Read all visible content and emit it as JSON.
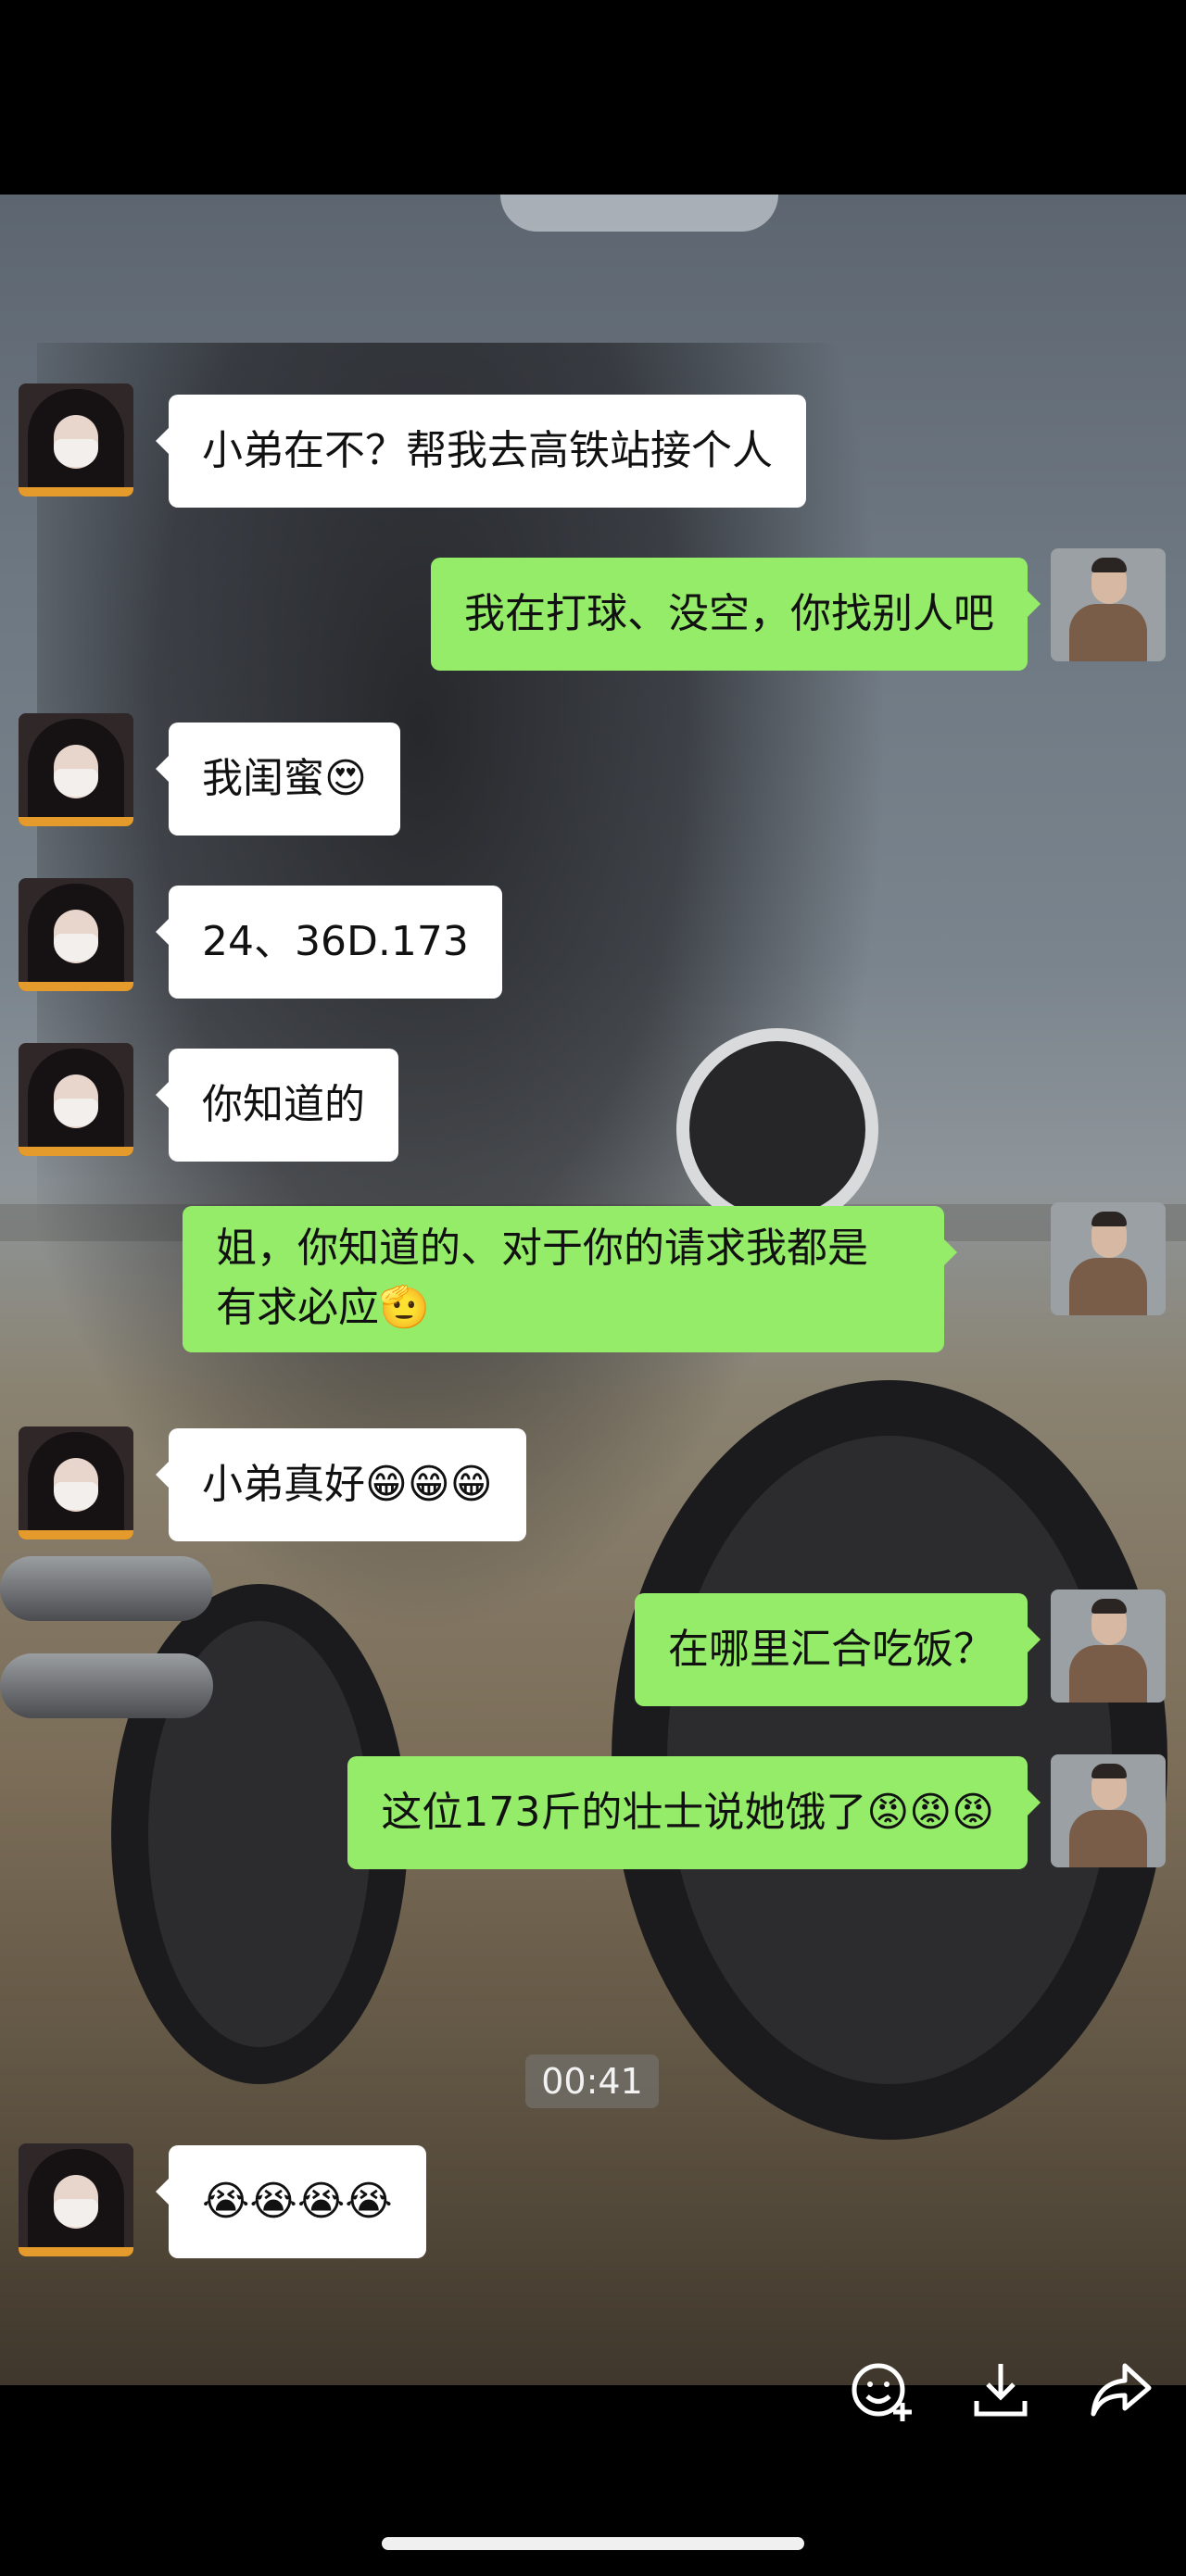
{
  "messages": [
    {
      "side": "left",
      "text": "小弟在不？帮我去高铁站接个人"
    },
    {
      "side": "right",
      "text": "我在打球、没空，你找别人吧"
    },
    {
      "side": "left",
      "text": "我闺蜜😍"
    },
    {
      "side": "left",
      "text": "24、36D.173"
    },
    {
      "side": "left",
      "text": "你知道的"
    },
    {
      "side": "right",
      "line1": "姐，你知道的、对于你的请求我都是",
      "line2": "有求必应🫡"
    },
    {
      "side": "left",
      "text": "小弟真好😁😁😁"
    },
    {
      "side": "right",
      "text": "在哪里汇合吃饭？"
    },
    {
      "side": "right",
      "text": "这位173斤的壮士说她饿了😡😡😡"
    },
    {
      "side": "left",
      "text": "😭😭😭😭"
    }
  ],
  "timestamp": "00:41",
  "video_overlay": {
    "icons": [
      "emoji-add-icon",
      "download-icon",
      "share-icon"
    ]
  },
  "colors": {
    "bubble_sent": "#95ec69",
    "bubble_received": "#ffffff"
  }
}
